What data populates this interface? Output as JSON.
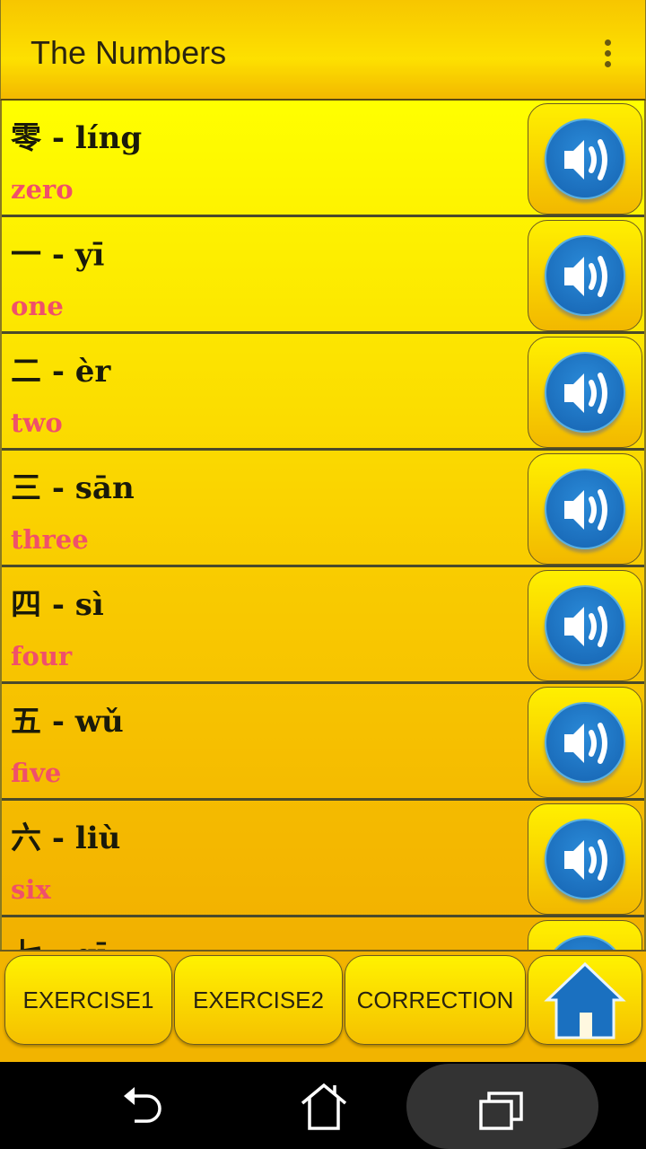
{
  "app_bar": {
    "title": "The Numbers",
    "menu_icon": "more-vert-icon"
  },
  "items": [
    {
      "chinese": "零 - líng",
      "english": "zero"
    },
    {
      "chinese": "一 - yī",
      "english": "one"
    },
    {
      "chinese": "二 - èr",
      "english": "two"
    },
    {
      "chinese": "三 - sān",
      "english": "three"
    },
    {
      "chinese": "四 - sì",
      "english": "four"
    },
    {
      "chinese": "五 - wǔ",
      "english": "five"
    },
    {
      "chinese": "六 - liù",
      "english": "six"
    },
    {
      "chinese": "七 - qī",
      "english": ""
    }
  ],
  "bottom_bar": {
    "exercise1": "EXERCISE1",
    "exercise2": "EXERCISE2",
    "correction": "CORRECTION",
    "home_icon": "home-icon"
  },
  "colors": {
    "accent_yellow": "#ffee00",
    "english_text": "#f0506a",
    "speaker_blue": "#1a6fc0"
  }
}
